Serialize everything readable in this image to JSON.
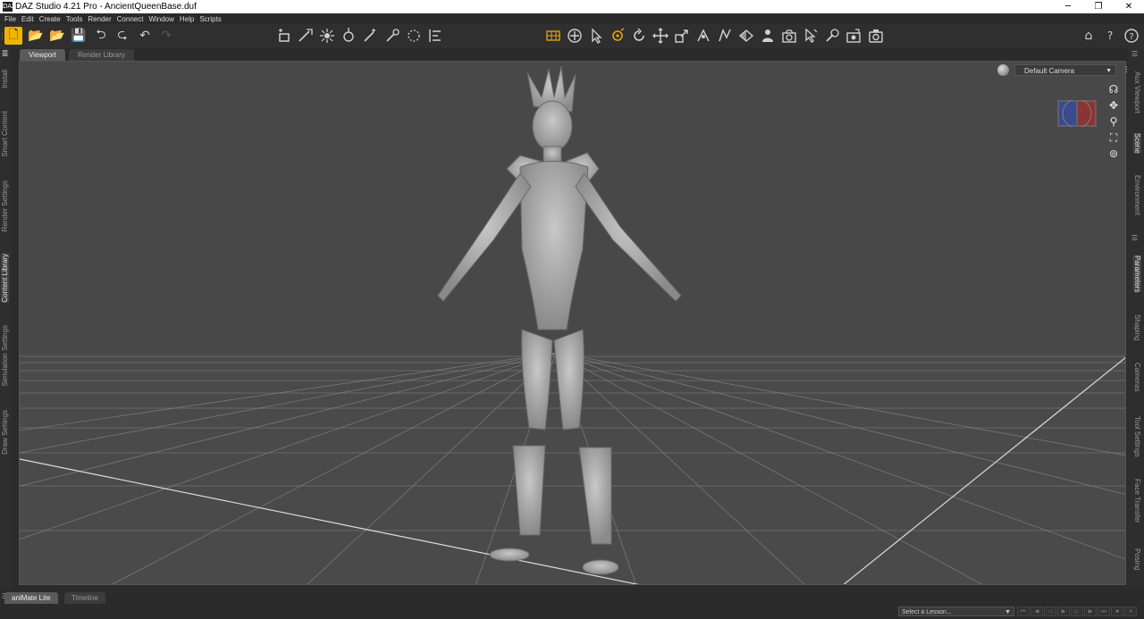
{
  "window": {
    "icon_label": "DAZ",
    "title": "DAZ Studio 4.21 Pro - AncientQueenBase.duf",
    "controls": [
      "─",
      "❐",
      "✕"
    ]
  },
  "menu": [
    "File",
    "Edit",
    "Create",
    "Tools",
    "Render",
    "Connect",
    "Window",
    "Help",
    "Scripts"
  ],
  "toolbar_icons": {
    "new": "🗋",
    "open": "📂",
    "merge": "📂",
    "save": "💾",
    "import": "⮌",
    "export": "⮎",
    "undo": "↶",
    "redo": "↷",
    "home": "⌂",
    "whats_this": "?",
    "help": "?"
  },
  "viewport_tabs": [
    "Viewport",
    "Render Library"
  ],
  "left_tabs": [
    "Install",
    "Smart Content",
    "Render Settings",
    "Content Library",
    "Simulation Settings",
    "Draw Settings"
  ],
  "right_tabs": [
    "Aux Viewport",
    "Scene",
    "Environment",
    "Parameters",
    "Shaping",
    "Cameras",
    "Tool Settings",
    "Face Transfer",
    "Posing"
  ],
  "camera": {
    "selected": "Default Camera",
    "arrow": "▼"
  },
  "bottom_tabs": [
    "aniMate Lite",
    "Timeline"
  ],
  "lesson": {
    "placeholder": "Select a Lesson...",
    "arrow": "▼"
  }
}
